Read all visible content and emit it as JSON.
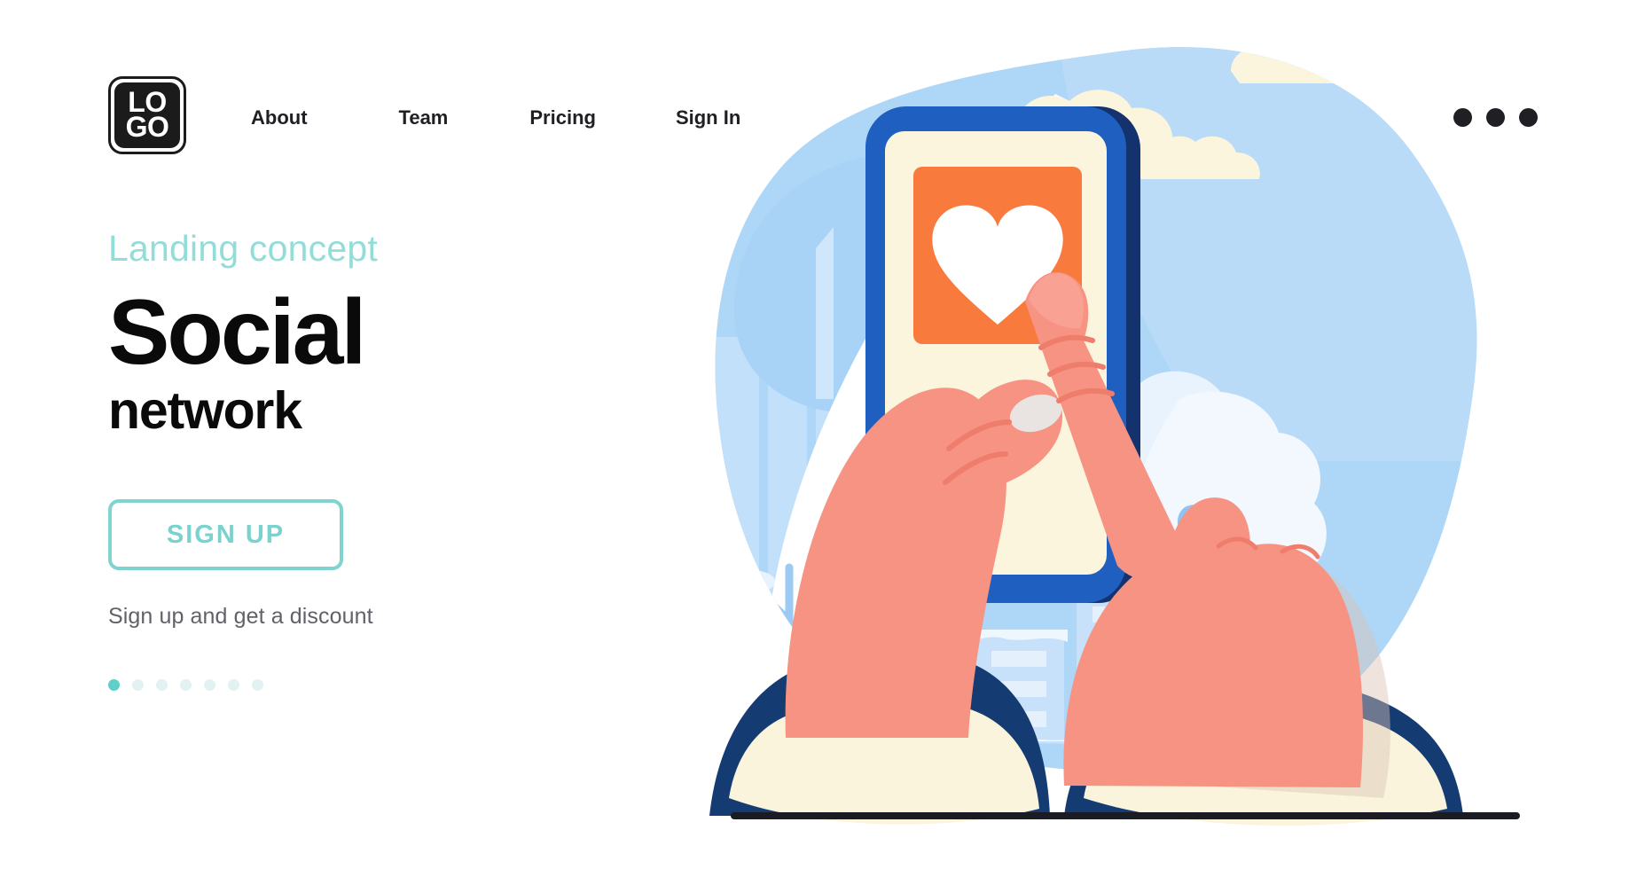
{
  "header": {
    "logo": {
      "name": "logo-mark",
      "line1": "LO",
      "line2": "GO"
    },
    "nav": [
      {
        "label": "About"
      },
      {
        "label": "Team"
      },
      {
        "label": "Pricing"
      },
      {
        "label": "Sign In"
      }
    ],
    "menu_icon": "three-dots-icon"
  },
  "hero": {
    "eyebrow": "Landing concept",
    "title_main": "Social",
    "title_sub": "network",
    "cta_label": "SIGN UP",
    "note": "Sign up and get a discount",
    "carousel": {
      "total": 7,
      "active_index": 0
    }
  },
  "illustration": {
    "alt": "hand-holding-phone-tapping-heart",
    "scene_items": [
      "background-blob",
      "clouds",
      "trees",
      "buildings",
      "leaves",
      "smartphone",
      "heart-icon",
      "pointing-hand",
      "holding-hand",
      "ground-line"
    ]
  },
  "colors": {
    "accent_teal": "#7FD4D0",
    "eyebrow_teal": "#93DDD9",
    "dot_active": "#5ECFC9",
    "dot_inactive": "#E2F2F2",
    "text_dark": "#0a0a0a",
    "text_gray": "#616169",
    "phone_blue": "#1F5FC0",
    "phone_blue_dark": "#13326E",
    "screen_cream": "#FBF5DE",
    "card_orange": "#F97A3D",
    "skin": "#F79382",
    "skin_shadow": "#EE7D6C",
    "blob_blue": "#AED6F7",
    "pale_blue": "#D3E7FB",
    "cuff_cream": "#FAF4DC",
    "sleeve_navy": "#153B73",
    "ground_line": "#1b1b24"
  }
}
